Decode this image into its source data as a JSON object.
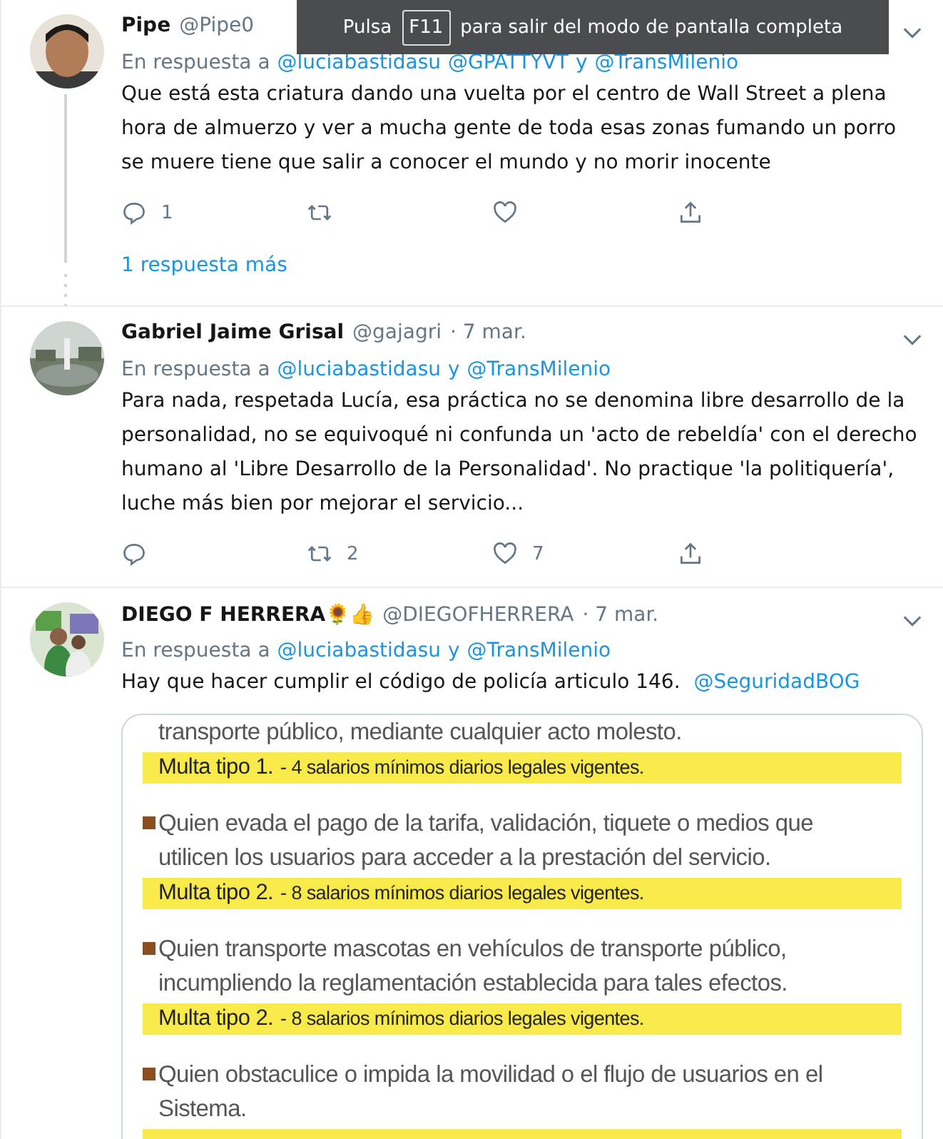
{
  "fullscreen_notice": {
    "before": "Pulsa",
    "key": "F11",
    "after": "para salir del modo de pantalla completa"
  },
  "tweets": [
    {
      "name": "Pipe",
      "handle": "@Pipe0",
      "reply_label": "En respuesta a",
      "mentions": [
        "@luciabastidasu",
        "@GPATTYVT"
      ],
      "last_mention": "@TransMilenio",
      "joiner": "y",
      "text": "Que está esta criatura dando una vuelta por el centro de Wall Street a plena hora de almuerzo y ver a mucha gente de toda esas zonas fumando un porro se muere tiene que salir a conocer el mundo y no morir inocente",
      "replies": "1",
      "thread": true,
      "more_replies": "1 respuesta más"
    },
    {
      "name": "Gabriel Jaime Grisal",
      "handle": "@gajagri",
      "date": "· 7 mar.",
      "reply_label": "En respuesta a",
      "mentions": [
        "@luciabastidasu"
      ],
      "last_mention": "@TransMilenio",
      "joiner": "y",
      "text": "Para nada, respetada Lucía, esa práctica no se denomina libre desarrollo de la personalidad, no se equivoqué ni confunda un 'acto de rebeldía' con el derecho humano al 'Libre Desarrollo de la Personalidad'. No practique 'la politiquería', luche más bien por mejorar el servicio...",
      "retweets": "2",
      "likes": "7",
      "thread": false
    },
    {
      "name": "DIEGO F HERRERA🌻👍",
      "handle": "@DIEGOFHERRERA",
      "date": "· 7 mar.",
      "reply_label": "En respuesta a",
      "mentions": [
        "@luciabastidasu"
      ],
      "last_mention": "@TransMilenio",
      "joiner": "y",
      "text": "Hay que hacer cumplir el código de policía articulo 146.",
      "text_link": "@SeguridadBOG",
      "thread": false,
      "document": [
        {
          "kind": "continuation",
          "text": "transporte público, mediante cualquier acto molesto.",
          "fine_type": "Multa tipo 1.",
          "fine_detail": "- 4 salarios mínimos diarios legales vigentes."
        },
        {
          "kind": "item",
          "text": "Quien evada el pago de la tarifa, validación, tiquete o medios que utilicen los usuarios para acceder a la prestación del servicio.",
          "fine_type": "Multa tipo 2.",
          "fine_detail": "- 8 salarios mínimos diarios legales vigentes."
        },
        {
          "kind": "item",
          "text": "Quien transporte mascotas en vehículos de transporte público, incumpliendo la reglamentación establecida para tales efectos.",
          "fine_type": "Multa tipo 2.",
          "fine_detail": "- 8 salarios mínimos diarios legales vigentes."
        },
        {
          "kind": "item",
          "text": "Quien obstaculice o impida la movilidad o el flujo de usuarios en el Sistema."
        }
      ]
    }
  ]
}
